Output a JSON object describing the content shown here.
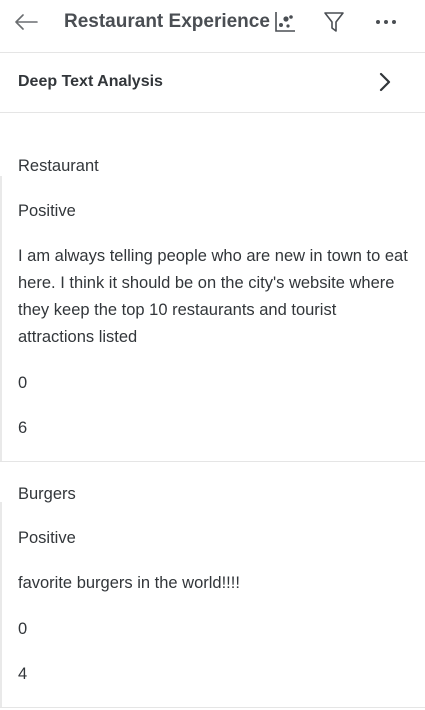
{
  "header": {
    "title": "Restaurant Experience"
  },
  "section": {
    "title": "Deep Text Analysis"
  },
  "records": [
    {
      "topic": "Restaurant",
      "sentiment": "Positive",
      "text": "I am always telling people who are new in town to eat here. I think it should be on the city's website where they keep the top 10 restaurants and tourist attractions listed",
      "value1": "0",
      "value2": "6"
    },
    {
      "topic": "Burgers",
      "sentiment": "Positive",
      "text": "favorite burgers in the world!!!!",
      "value1": "0",
      "value2": "4"
    }
  ],
  "icons": {
    "back": "arrow-left-icon",
    "scatter": "scatter-chart-icon",
    "filter": "filter-icon",
    "more": "more-horizontal-icon",
    "chevron": "chevron-right-icon"
  },
  "colors": {
    "title": "#4a4e53",
    "text": "#32363a",
    "divider": "#e5e5e5"
  }
}
